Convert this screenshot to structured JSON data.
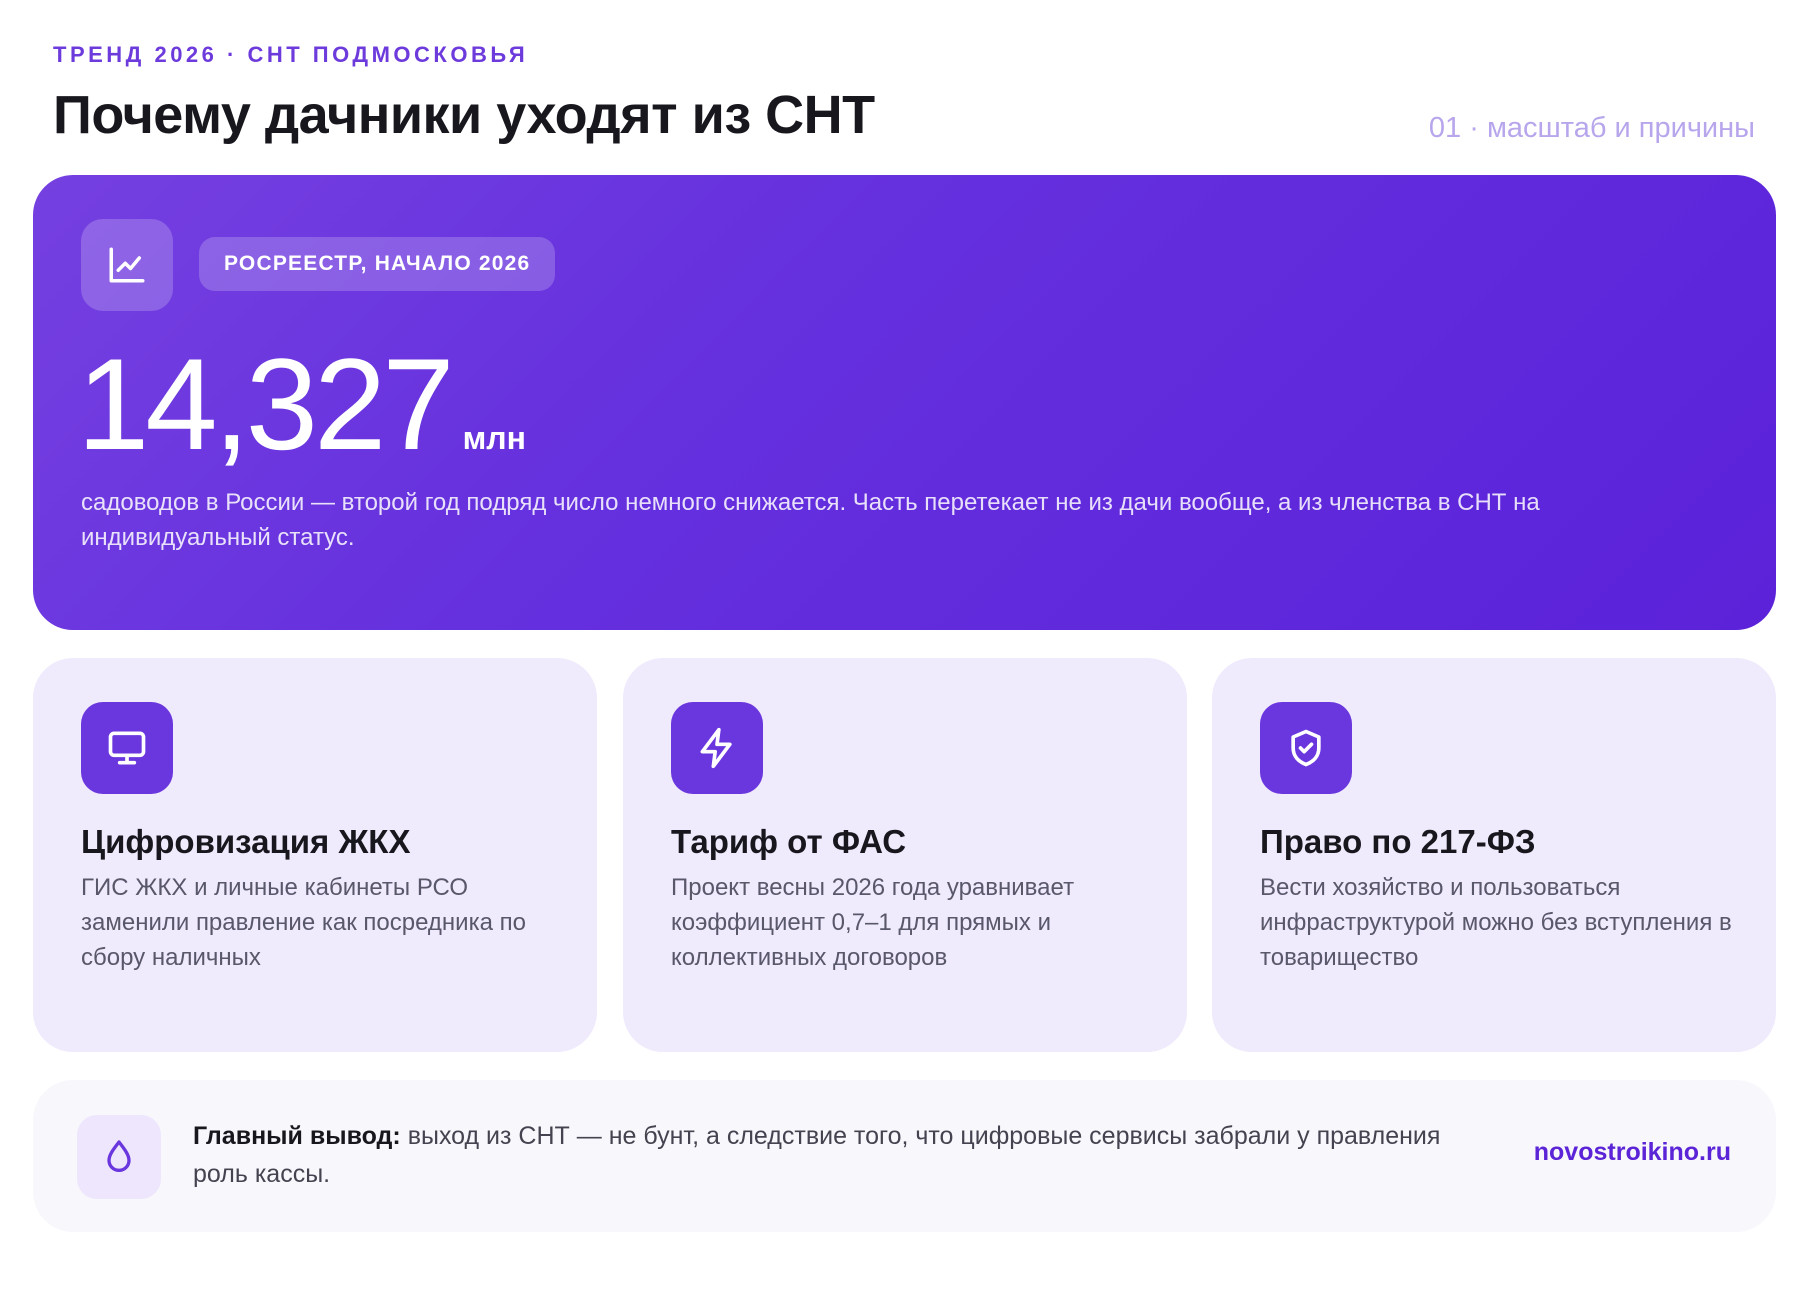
{
  "header": {
    "eyebrow": "ТРЕНД 2026 · СНТ ПОДМОСКОВЬЯ",
    "title": "Почему дачники уходят из СНТ",
    "section_label": "01 · масштаб и причины"
  },
  "hero": {
    "icon": "line-chart-icon",
    "badge": "РОСРЕЕСТР, НАЧАЛО 2026",
    "number": "14,327",
    "unit": "млн",
    "description": "садоводов в России — второй год подряд число немного снижается. Часть перетекает не из дачи вообще, а из членства в СНТ на индивидуальный статус."
  },
  "cards": [
    {
      "icon": "monitor-icon",
      "title": "Цифровизация ЖКХ",
      "text": "ГИС ЖКХ и личные кабинеты РСО заменили правление как посредника по сбору наличных"
    },
    {
      "icon": "lightning-icon",
      "title": "Тариф от ФАС",
      "text": "Проект весны 2026 года уравнивает коэффициент 0,7–1 для прямых и коллективных договоров"
    },
    {
      "icon": "shield-check-icon",
      "title": "Право по 217-ФЗ",
      "text": "Вести хозяйство и пользоваться инфраструктурой можно без вступления в товарищество"
    }
  ],
  "conclusion": {
    "icon": "drop-icon",
    "label": "Главный вывод:",
    "text": " выход из СНТ — не бунт, а следствие того, что цифровые сервисы забрали у правления роль кассы.",
    "site": "novostroikino.ru"
  },
  "colors": {
    "accent": "#6d3bdc",
    "hero_gradient_start": "#7540e0",
    "hero_gradient_end": "#5b22d9",
    "card_bg": "#f0eafd",
    "conclusion_bg": "#f8f7fc"
  }
}
